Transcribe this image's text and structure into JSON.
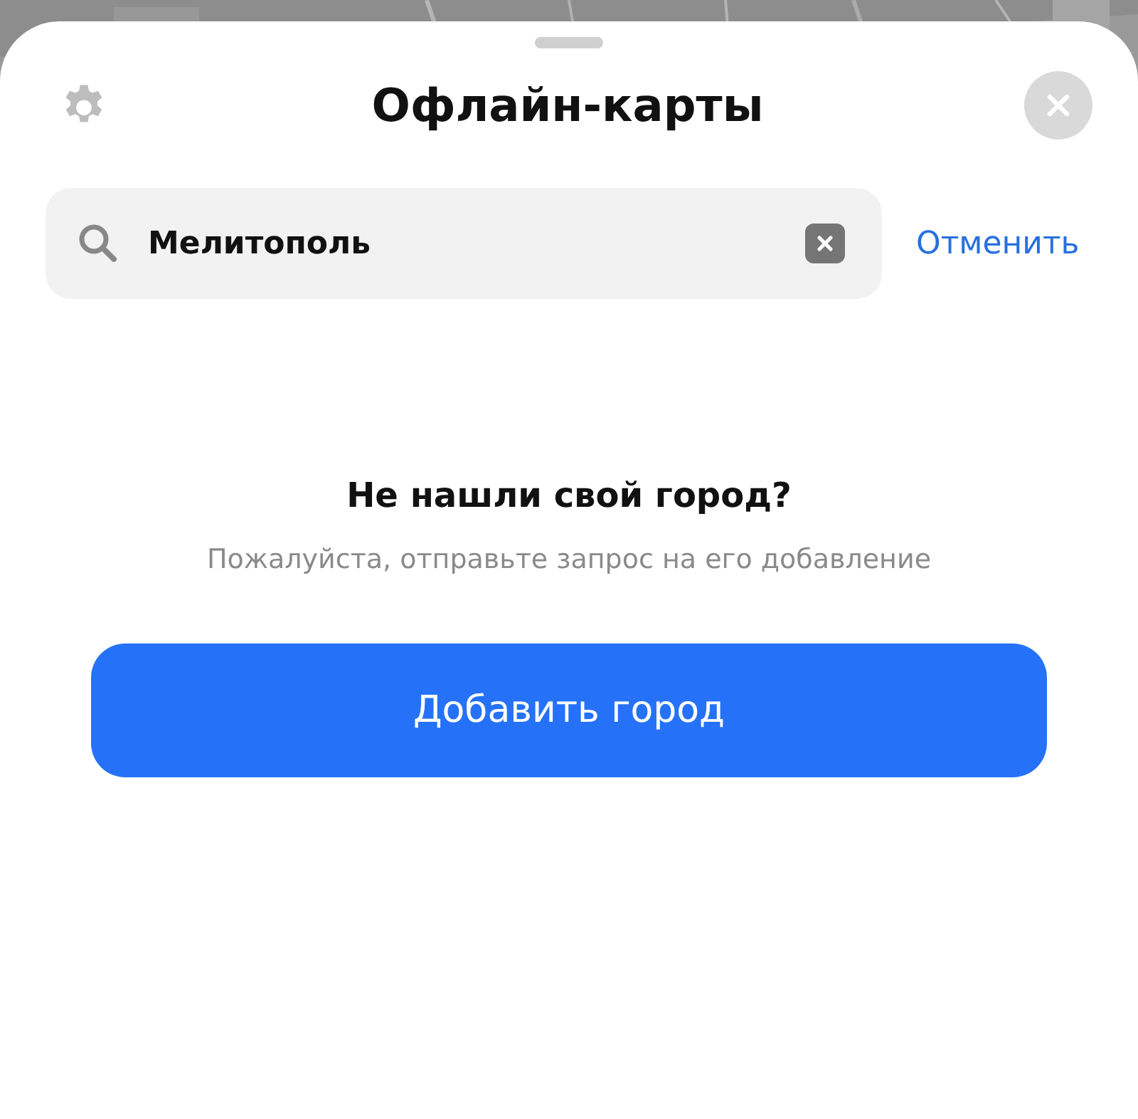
{
  "header": {
    "title": "Офлайн-карты"
  },
  "search": {
    "value": "Мелитополь",
    "cancel": "Отменить"
  },
  "empty_state": {
    "heading": "Не нашли свой город?",
    "message": "Пожалуйста, отправьте запрос на его добавление",
    "button": "Добавить город"
  }
}
